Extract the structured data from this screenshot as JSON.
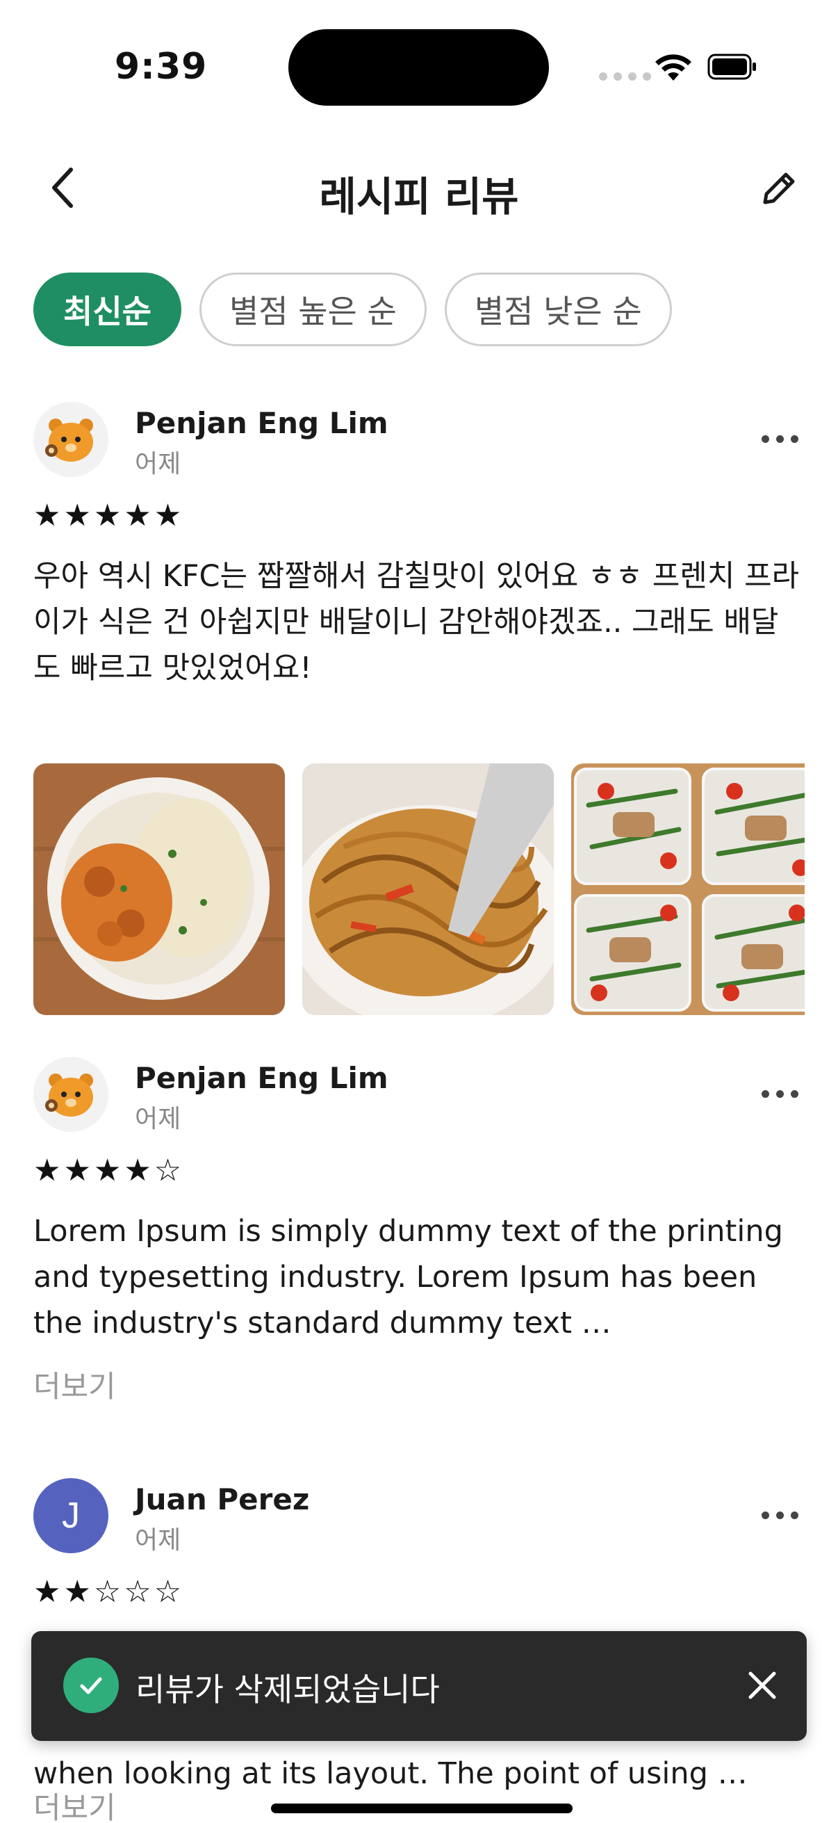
{
  "status_bar": {
    "time": "9:39"
  },
  "header": {
    "title": "레시피 리뷰"
  },
  "filters": [
    {
      "label": "최신순",
      "active": true
    },
    {
      "label": "별점 높은 순",
      "active": false
    },
    {
      "label": "별점 낮은 순",
      "active": false
    }
  ],
  "reviews": [
    {
      "author": "Penjan Eng Lim",
      "date": "어제",
      "rating": 5,
      "stars": "★★★★★",
      "text": "우아 역시 KFC는 짭짤해서 감칠맛이 있어요 ㅎㅎ 프렌치 프라이가 식은 건 아쉽지만 배달이니 감안해야겠죠.. 그래도 배달도 빠르고 맛있었어요!",
      "photos": [
        "curry-rice-photo",
        "noodles-photo",
        "meal-prep-photo"
      ]
    },
    {
      "author": "Penjan Eng Lim",
      "date": "어제",
      "rating": 4,
      "stars": "★★★★☆",
      "text": "Lorem Ipsum is simply dummy text of the printing and typesetting industry. Lorem Ipsum has been the industry's standard dummy text …",
      "more_label": "더보기"
    },
    {
      "author": "Juan Perez",
      "avatar_letter": "J",
      "date": "어제",
      "rating": 2,
      "stars": "★★☆☆☆",
      "text_tail": "when looking at its layout. The point of using …",
      "more_label": "더보기"
    }
  ],
  "toast": {
    "message": "리뷰가 삭제되었습니다"
  },
  "colors": {
    "accent": "#1f8f63",
    "toast_bg": "#2a2a2a",
    "toast_check": "#2fae7c",
    "avatar_j": "#5563bf"
  }
}
